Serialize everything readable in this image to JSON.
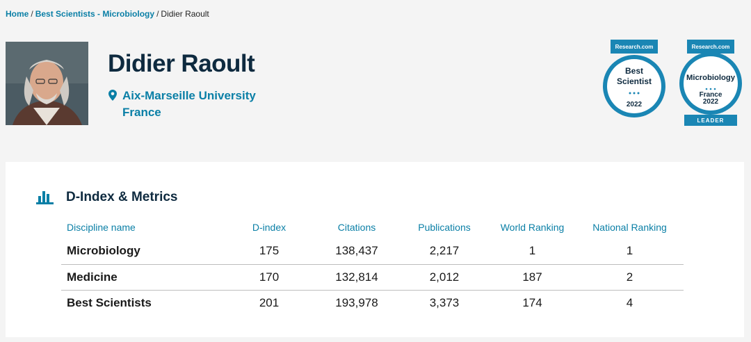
{
  "breadcrumb": {
    "home": "Home",
    "sep1": "/",
    "category": "Best Scientists - Microbiology",
    "sep2": "/",
    "current": "Didier Raoult"
  },
  "profile": {
    "name": "Didier Raoult",
    "institution": "Aix-Marseille University",
    "country": "France"
  },
  "badges": [
    {
      "brand": "Research.com",
      "line1": "Best",
      "line2": "Scientist",
      "year": "2022"
    },
    {
      "brand": "Research.com",
      "line1": "Microbiology",
      "line2": "France",
      "year": "2022",
      "ribbon": "LEADER"
    }
  ],
  "metrics": {
    "title": "D-Index & Metrics",
    "headers": [
      "Discipline name",
      "D-index",
      "Citations",
      "Publications",
      "World Ranking",
      "National Ranking"
    ],
    "rows": [
      [
        "Microbiology",
        "175",
        "138,437",
        "2,217",
        "1",
        "1"
      ],
      [
        "Medicine",
        "170",
        "132,814",
        "2,012",
        "187",
        "2"
      ],
      [
        "Best Scientists",
        "201",
        "193,978",
        "3,373",
        "174",
        "4"
      ]
    ]
  },
  "colors": {
    "accent": "#0a7fa6",
    "heading": "#0e2a3f",
    "badge": "#1a86b4"
  }
}
